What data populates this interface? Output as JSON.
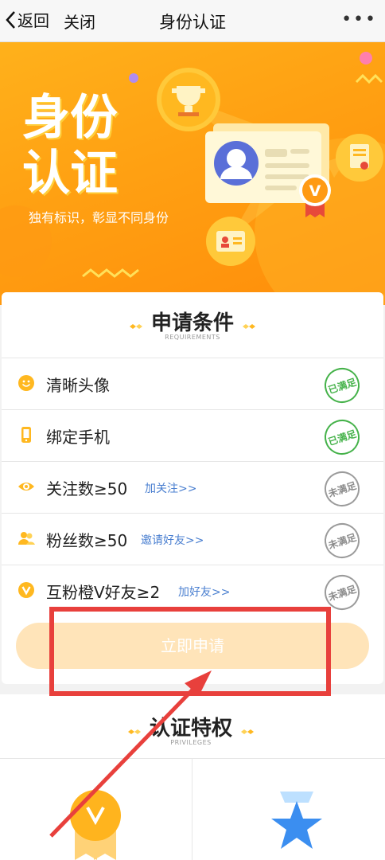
{
  "nav": {
    "back_label": "返回",
    "close_label": "关闭",
    "title": "身份认证",
    "more_label": "•••"
  },
  "banner": {
    "title": "身份认证",
    "subtitle": "独有标识，彰显不同身份"
  },
  "requirements": {
    "title": "申请条件",
    "subtitle": "REQUIREMENTS",
    "items": [
      {
        "label": "清晰头像",
        "link": "",
        "status": "已满足",
        "icon": "smile-icon"
      },
      {
        "label": "绑定手机",
        "link": "",
        "status": "已满足",
        "icon": "phone-icon"
      },
      {
        "label": "关注数≥50",
        "link": "加关注>>",
        "status": "未满足",
        "icon": "eye-icon"
      },
      {
        "label": "粉丝数≥50",
        "link": "邀请好友>>",
        "status": "未满足",
        "icon": "fans-icon"
      },
      {
        "label": "互粉橙V好友≥2",
        "link": "加好友>>",
        "status": "未满足",
        "icon": "orange-v-icon"
      }
    ],
    "apply_label": "立即申请"
  },
  "privileges": {
    "title": "认证特权",
    "subtitle": "PRIVILEGES"
  },
  "colors": {
    "accent": "#ffa012",
    "link": "#4a7fd0",
    "ok": "#45b24a",
    "annotation": "#e8403c"
  }
}
